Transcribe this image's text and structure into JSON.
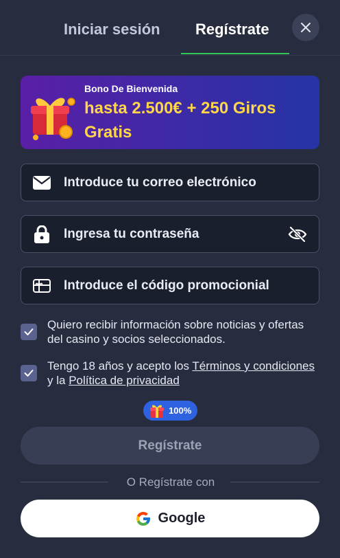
{
  "tabs": {
    "login": "Iniciar sesión",
    "register": "Regístrate"
  },
  "bonus": {
    "title": "Bono De Bienvenida",
    "amount": "hasta 2.500€ + 250 Giros Gratis"
  },
  "form": {
    "email_placeholder": "Introduce tu correo electrónico",
    "password_placeholder": "Ingresa tu contraseña",
    "promo_placeholder": "Introduce el código promocionial"
  },
  "consents": {
    "marketing": {
      "checked": true,
      "text": "Quiero recibir información sobre noticias y ofertas del casino y socios seleccionados."
    },
    "terms": {
      "checked": true,
      "prefix": "Tengo 18 años y acepto los ",
      "terms_link": "Términos y condiciones",
      "middle": " y la ",
      "privacy_link": "Política de privacidad"
    }
  },
  "progress_badge": {
    "value": "100%"
  },
  "submit_label": "Regístrate",
  "divider_text": "O Regístrate con",
  "google_label": "Google",
  "colors": {
    "background": "#272d3f",
    "accent_green": "#31c85a",
    "bonus_text": "#ffd64a",
    "badge_blue": "#2f62e0"
  },
  "icons": {
    "close": "close-icon",
    "email": "envelope-icon",
    "password": "lock-icon",
    "visibility": "eye-off-icon",
    "promo": "gift-card-icon",
    "badge": "gift-icon",
    "google": "google-logo-icon"
  }
}
